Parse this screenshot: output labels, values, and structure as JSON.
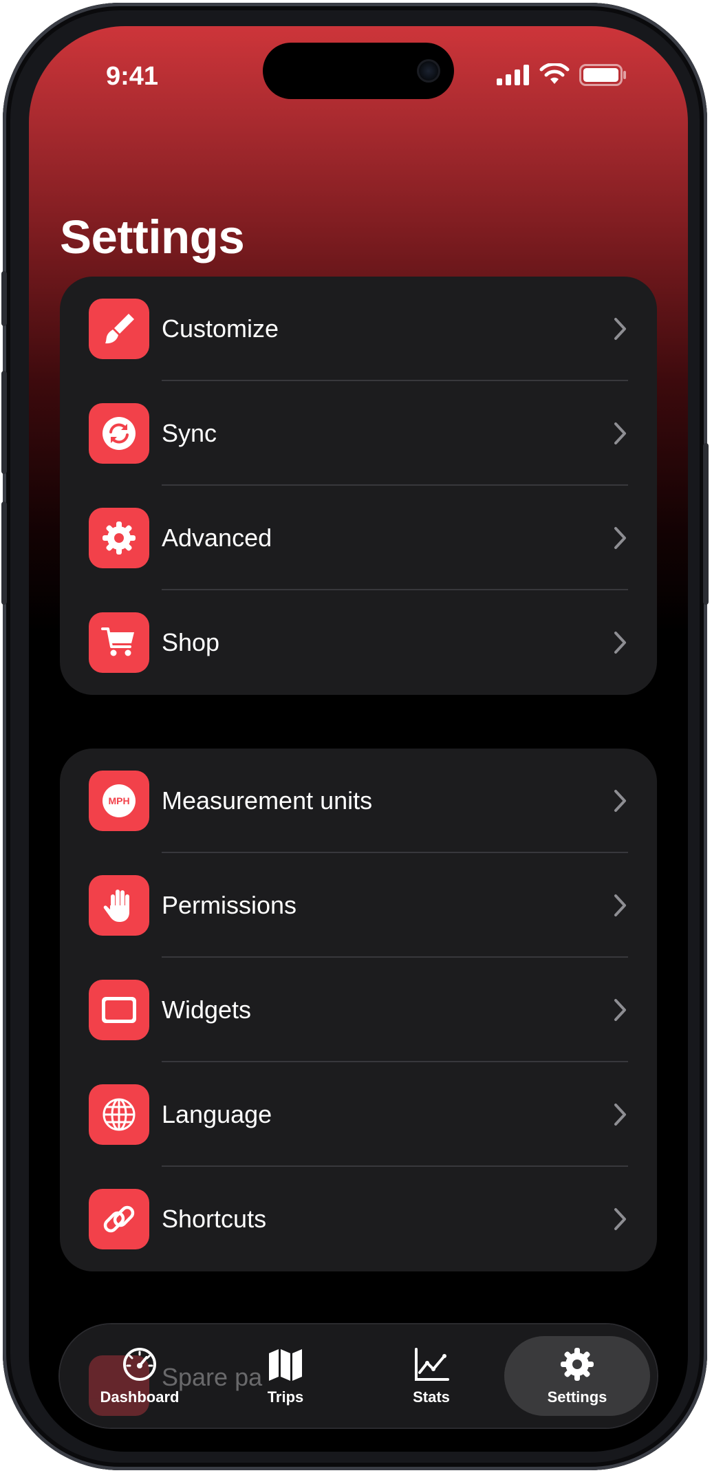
{
  "status_bar": {
    "time": "9:41",
    "signal_icon": "cellular-signal-icon",
    "wifi_icon": "wifi-icon",
    "battery_icon": "battery-icon"
  },
  "page": {
    "title": "Settings"
  },
  "groups": [
    {
      "items": [
        {
          "label": "Customize",
          "icon": "paintbrush-icon"
        },
        {
          "label": "Sync",
          "icon": "sync-icon"
        },
        {
          "label": "Advanced",
          "icon": "gear-icon"
        },
        {
          "label": "Shop",
          "icon": "cart-icon"
        }
      ]
    },
    {
      "items": [
        {
          "label": "Measurement units",
          "icon": "mph-icon",
          "icon_text": "MPH"
        },
        {
          "label": "Permissions",
          "icon": "hand-icon"
        },
        {
          "label": "Widgets",
          "icon": "widget-icon"
        },
        {
          "label": "Language",
          "icon": "globe-icon"
        },
        {
          "label": "Shortcuts",
          "icon": "link-icon"
        }
      ]
    }
  ],
  "tab_bar": {
    "tabs": [
      {
        "label": "Dashboard",
        "icon": "speedometer-icon",
        "active": false
      },
      {
        "label": "Trips",
        "icon": "map-icon",
        "active": false
      },
      {
        "label": "Stats",
        "icon": "chart-icon",
        "active": false
      },
      {
        "label": "Settings",
        "icon": "gear-icon",
        "active": true
      }
    ],
    "behind_text": "Spare pa"
  },
  "colors": {
    "accent": "#f2414a",
    "card": "#1c1c1e",
    "header_gradient_top": "#cd353a",
    "background": "#000000"
  }
}
